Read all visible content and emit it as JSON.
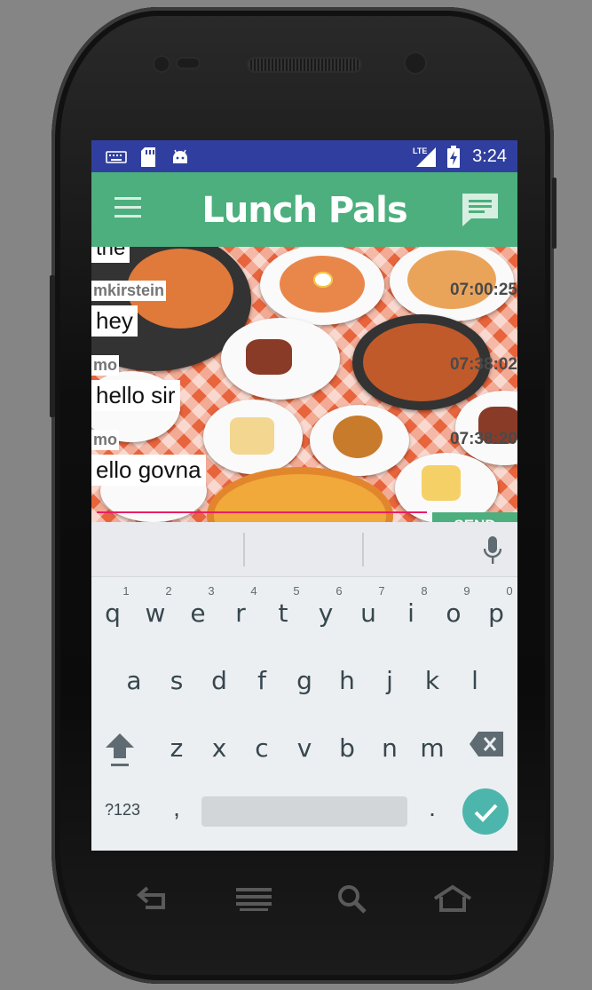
{
  "status_bar": {
    "time": "3:24",
    "network": "LTE",
    "icons": [
      "keyboard-icon",
      "sd-card-icon",
      "android-icon",
      "lte-signal-icon",
      "battery-charging-icon"
    ]
  },
  "app_bar": {
    "title": "Lunch Pals",
    "menu_icon": "hamburger-menu-icon",
    "chat_icon": "chat-icon",
    "color": "#4caf7d"
  },
  "chat": {
    "partial_top_text": "the",
    "messages": [
      {
        "user": "mkirstein",
        "text": "hey",
        "time": "07:00:25"
      },
      {
        "user": "mo",
        "text": "hello sir",
        "time": "07:38:02"
      },
      {
        "user": "mo",
        "text": "ello govna",
        "time": "07:38:20"
      }
    ],
    "send_label": "SEND"
  },
  "keyboard": {
    "row1": [
      {
        "char": "q",
        "hint": "1"
      },
      {
        "char": "w",
        "hint": "2"
      },
      {
        "char": "e",
        "hint": "3"
      },
      {
        "char": "r",
        "hint": "4"
      },
      {
        "char": "t",
        "hint": "5"
      },
      {
        "char": "y",
        "hint": "6"
      },
      {
        "char": "u",
        "hint": "7"
      },
      {
        "char": "i",
        "hint": "8"
      },
      {
        "char": "o",
        "hint": "9"
      },
      {
        "char": "p",
        "hint": "0"
      }
    ],
    "row2": [
      "a",
      "s",
      "d",
      "f",
      "g",
      "h",
      "j",
      "k",
      "l"
    ],
    "row3": [
      "z",
      "x",
      "c",
      "v",
      "b",
      "n",
      "m"
    ],
    "symbols_label": "?123",
    "comma": ",",
    "period": ".",
    "accent_color": "#4db6ac"
  },
  "hardware_nav": [
    "back-icon",
    "menu-icon",
    "search-icon",
    "home-icon"
  ]
}
